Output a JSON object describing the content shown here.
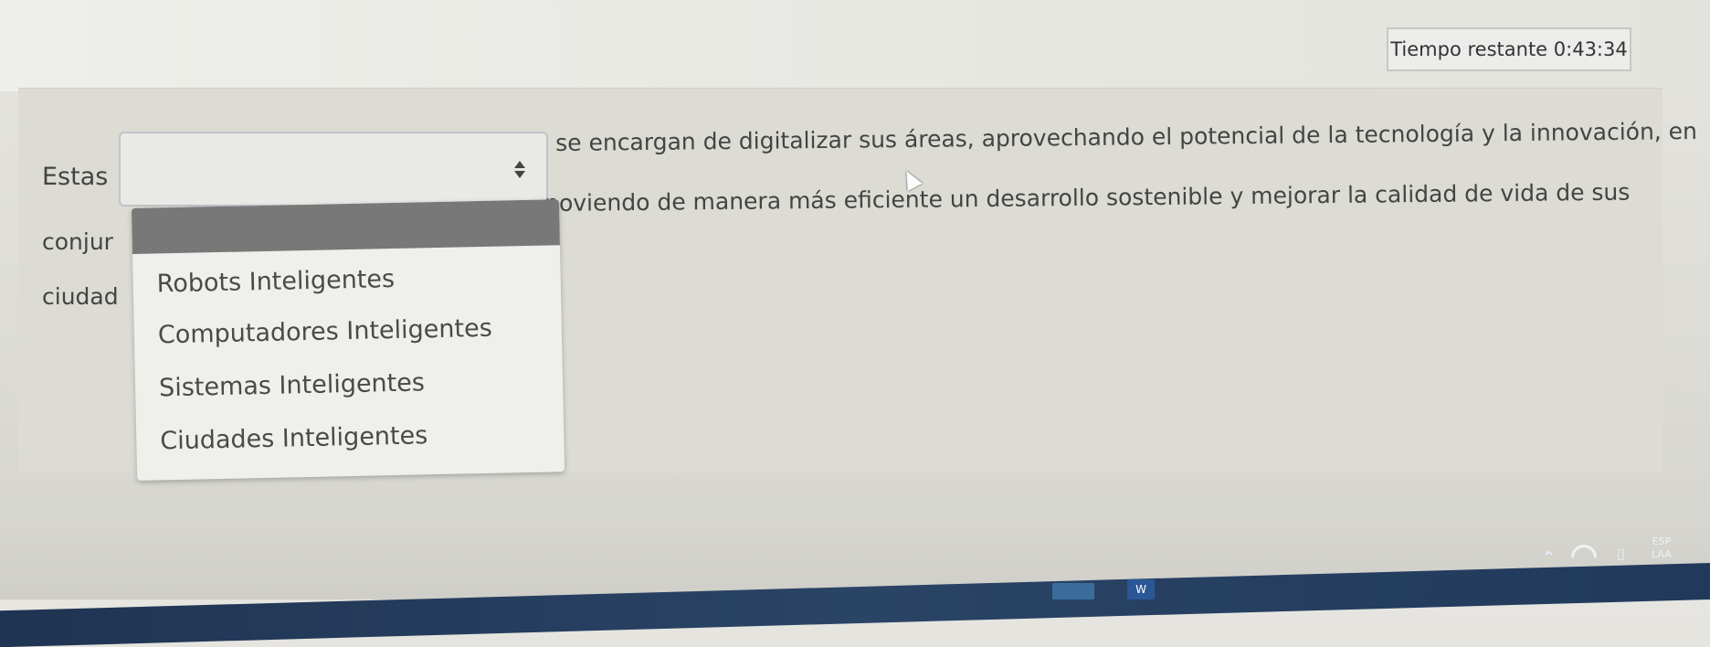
{
  "timer": {
    "text": "Tiempo restante 0:43:34"
  },
  "question": {
    "word_1": "Estas",
    "line_1_rest": "se encargan de digitalizar sus áreas, aprovechando el potencial de la tecnología y la innovación, en",
    "line_2_start": "conjur",
    "line_2_rest": "noviendo de manera más eficiente un desarrollo sostenible y mejorar la calidad de vida de sus",
    "line_3_start": "ciudad"
  },
  "select": {
    "value": "",
    "options": [
      "Robots Inteligentes",
      "Computadores Inteligentes",
      "Sistemas Inteligentes",
      "Ciudades Inteligentes"
    ]
  },
  "taskbar": {
    "word_icon_letter": "W",
    "lang_line_1": "ESP",
    "lang_line_2": "LAA"
  },
  "colors": {
    "dropdown_highlight": "#787878",
    "taskbar": "#1f3452"
  },
  "icons": [
    "select-arrows-icon",
    "mouse-cursor-icon",
    "tray-chevron-icon",
    "network-icon",
    "volume-icon",
    "word-icon"
  ]
}
